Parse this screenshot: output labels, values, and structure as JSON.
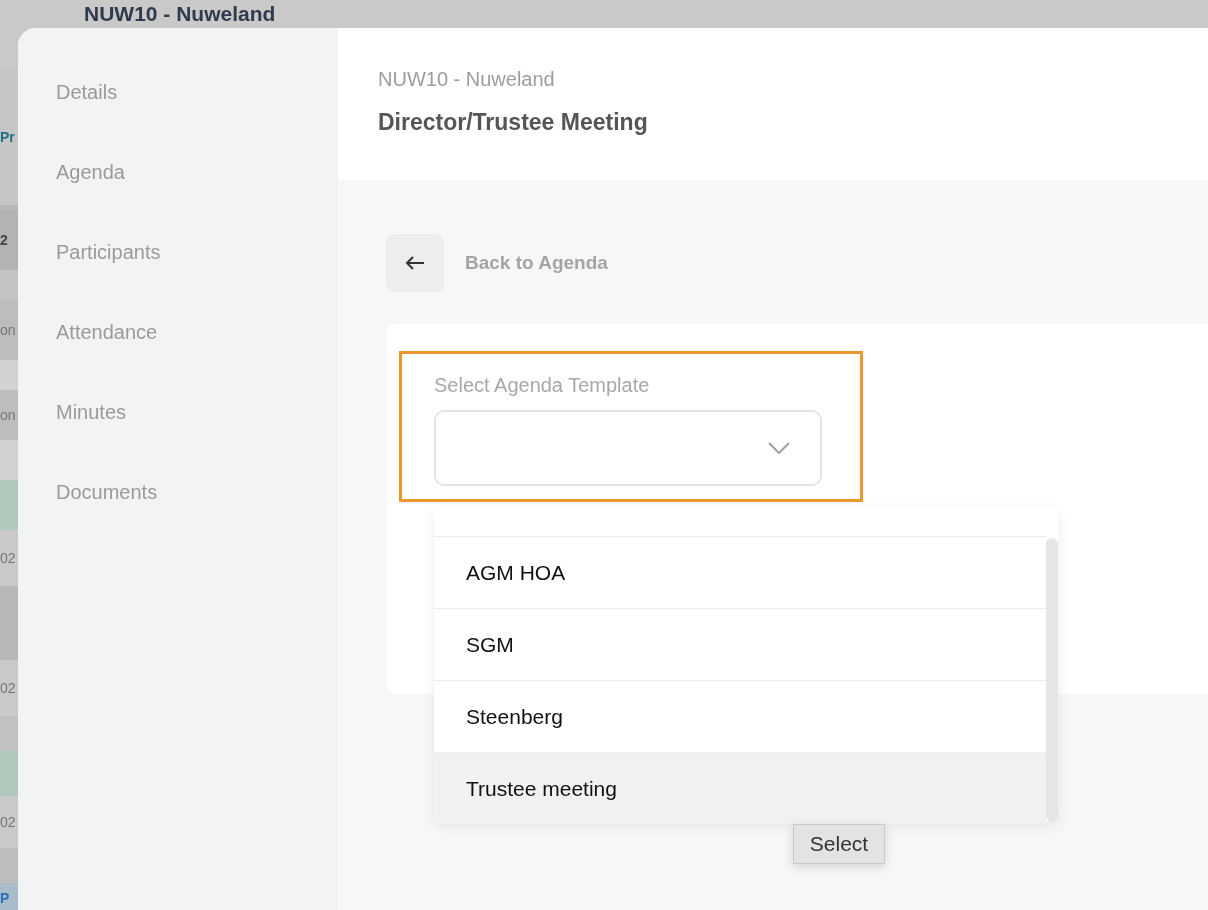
{
  "background": {
    "title": "NUW10 - Nuweland",
    "fragments": [
      {
        "text": "Pr",
        "kind": "link"
      },
      {
        "text": "2",
        "kind": "bold"
      },
      {
        "text": "on",
        "kind": "plain"
      },
      {
        "text": "on",
        "kind": "plain"
      },
      {
        "text": "02",
        "kind": "plain"
      },
      {
        "text": "02",
        "kind": "plain"
      },
      {
        "text": "02",
        "kind": "plain"
      },
      {
        "text": "P",
        "kind": "tag"
      }
    ]
  },
  "sidebar": {
    "items": [
      {
        "label": "Details",
        "selected": false
      },
      {
        "label": "Agenda",
        "selected": false
      },
      {
        "label": "Participants",
        "selected": false
      },
      {
        "label": "Attendance",
        "selected": false
      },
      {
        "label": "Minutes",
        "selected": false
      },
      {
        "label": "Documents",
        "selected": false
      }
    ]
  },
  "header": {
    "subtitle": "NUW10 - Nuweland",
    "title": "Director/Trustee Meeting"
  },
  "back": {
    "label": "Back to Agenda"
  },
  "template_field": {
    "label": "Select Agenda Template",
    "focused": true
  },
  "dropdown": {
    "options": [
      {
        "label": "AGM HOA",
        "selected": false
      },
      {
        "label": "SGM",
        "selected": false
      },
      {
        "label": "Steenberg",
        "selected": false
      },
      {
        "label": "Trustee meeting",
        "selected": true
      }
    ]
  },
  "tooltip": {
    "text": "Select"
  }
}
